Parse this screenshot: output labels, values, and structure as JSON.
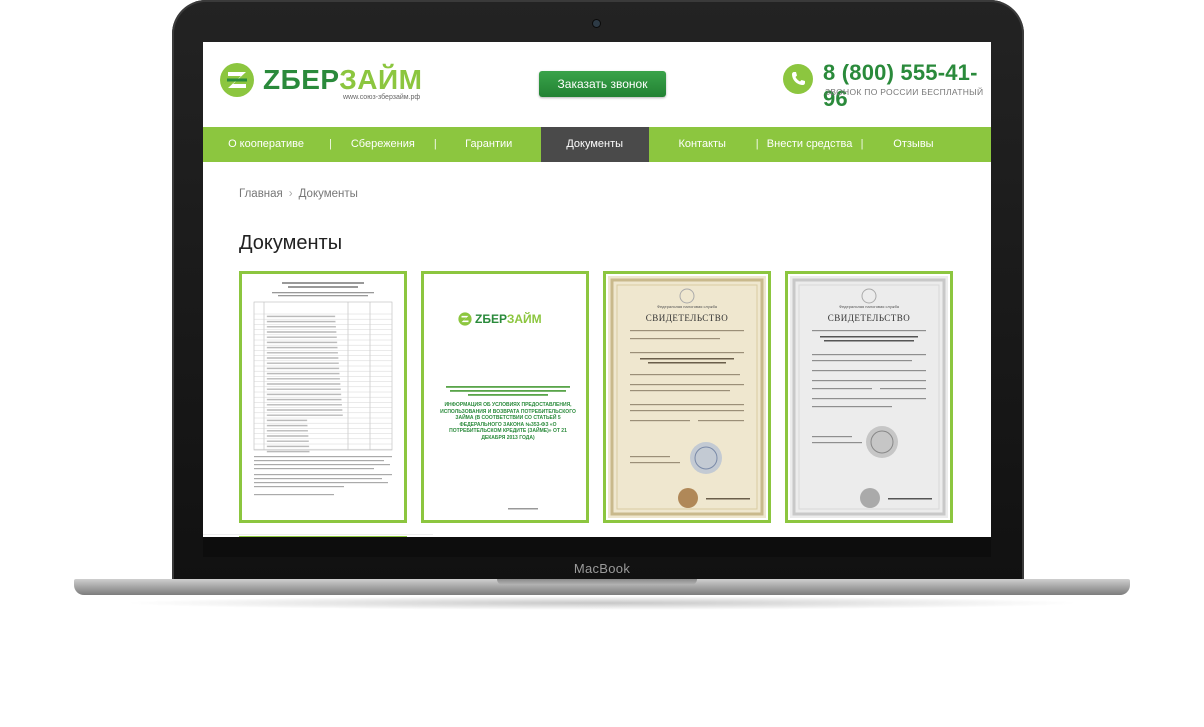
{
  "device": {
    "brand": "MacBook"
  },
  "header": {
    "logo_text_a": "ZБЕР",
    "logo_text_b": "ЗАЙМ",
    "logo_url": "www.союз-зберзайм.рф",
    "call_button": "Заказать звонок",
    "phone": "8 (800) 555-41-96",
    "phone_note": "ЗВОНОК ПО РОССИИ БЕСПЛАТНЫЙ"
  },
  "nav": {
    "items": [
      {
        "label": "О кооперативе",
        "active": false
      },
      {
        "label": "Сбережения",
        "active": false
      },
      {
        "label": "Гарантии",
        "active": false
      },
      {
        "label": "Документы",
        "active": true
      },
      {
        "label": "Контакты",
        "active": false
      },
      {
        "label": "Внести средства",
        "active": false
      },
      {
        "label": "Отзывы",
        "active": false
      }
    ]
  },
  "breadcrumb": {
    "home": "Главная",
    "current": "Документы"
  },
  "page": {
    "title": "Документы"
  },
  "documents": {
    "doc2": {
      "logo_text_a": "ZБЕР",
      "logo_text_b": "ЗАЙМ",
      "info": "ИНФОРМАЦИЯ ОБ УСЛОВИЯХ ПРЕДОСТАВЛЕНИЯ, ИСПОЛЬЗОВАНИЯ И ВОЗВРАТА ПОТРЕБИТЕЛЬСКОГО ЗАЙМА (В СООТВЕТСТВИИ СО СТАТЬЕЙ 5 ФЕДЕРАЛЬНОГО ЗАКОНА №353-ФЗ «О ПОТРЕБИТЕЛЬСКОМ КРЕДИТЕ (ЗАЙМЕ)» ОТ 21 ДЕКАБРЯ 2013 ГОДА)"
    },
    "doc3": {
      "agency": "Федеральная налоговая служба",
      "title": "СВИДЕТЕЛЬСТВО"
    },
    "doc4": {
      "agency": "Федеральная налоговая служба",
      "title": "СВИДЕТЕЛЬСТВО"
    }
  },
  "colors": {
    "brand_green": "#2a8a3b",
    "accent_green": "#8cc63f",
    "active_nav": "#4a4a4a"
  }
}
